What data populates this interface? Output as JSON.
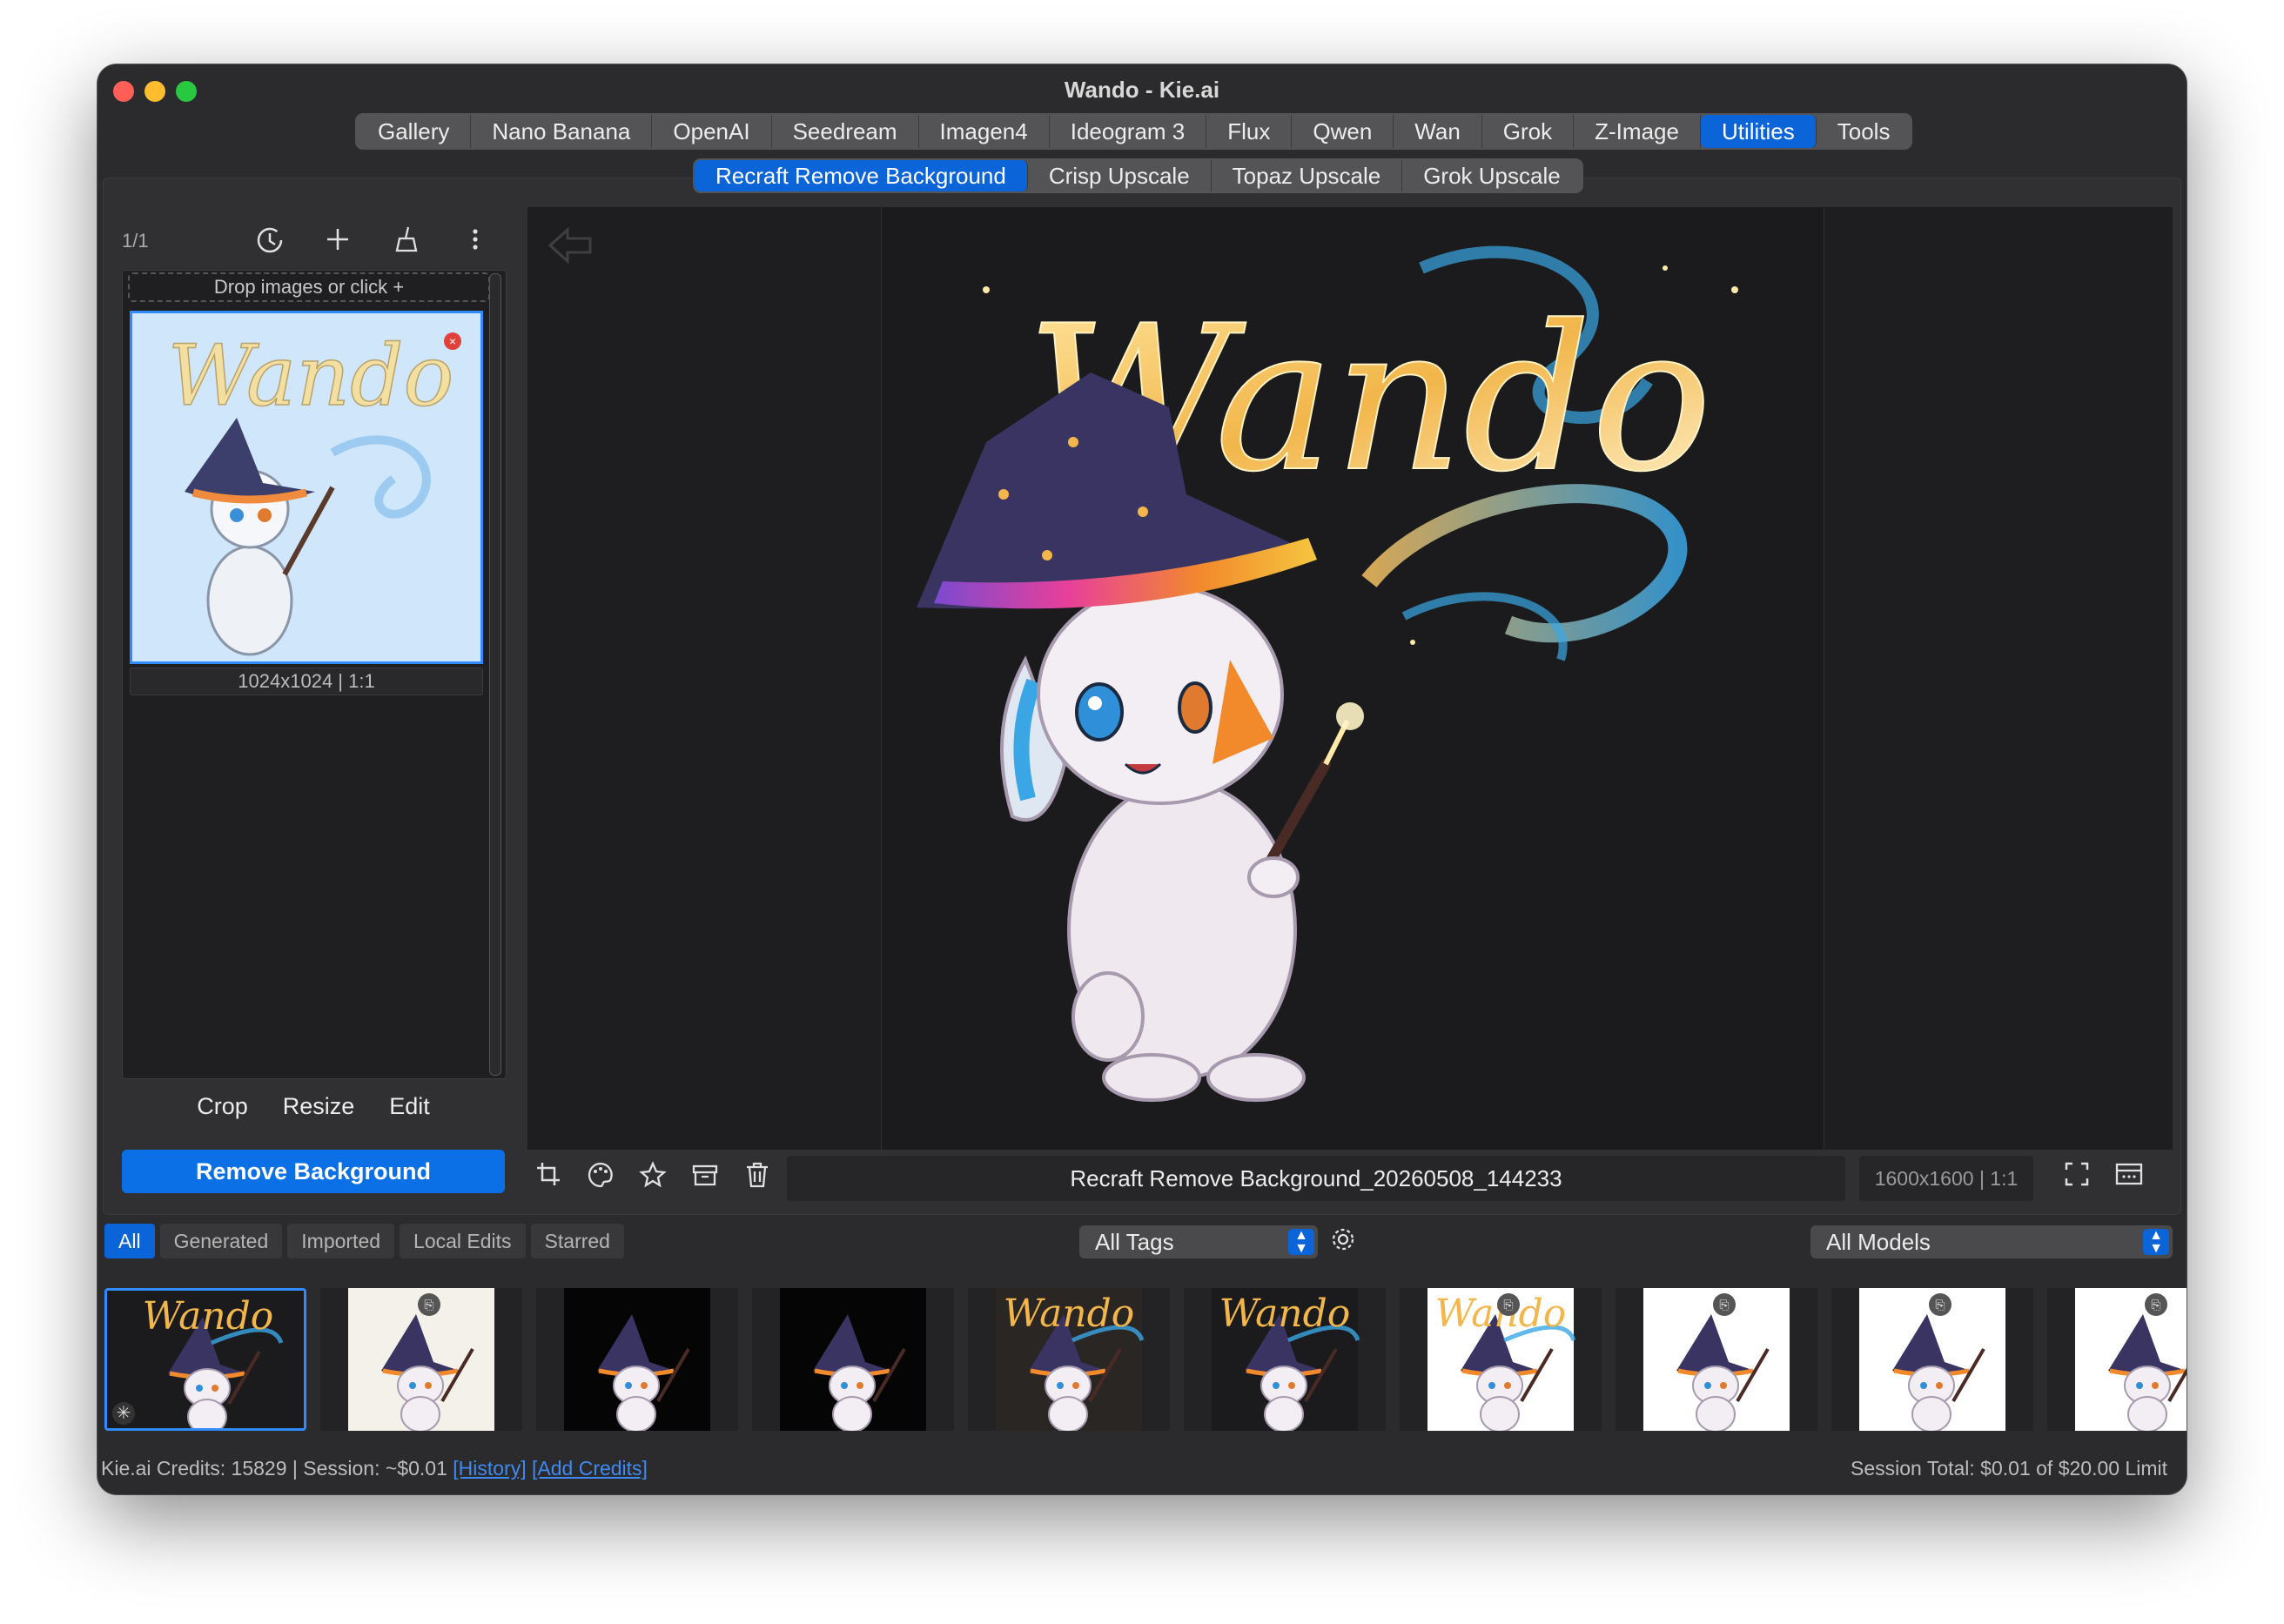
{
  "window": {
    "title": "Wando - Kie.ai"
  },
  "main_tabs": [
    {
      "label": "Gallery"
    },
    {
      "label": "Nano Banana"
    },
    {
      "label": "OpenAI"
    },
    {
      "label": "Seedream"
    },
    {
      "label": "Imagen4"
    },
    {
      "label": "Ideogram 3"
    },
    {
      "label": "Flux"
    },
    {
      "label": "Qwen"
    },
    {
      "label": "Wan"
    },
    {
      "label": "Grok"
    },
    {
      "label": "Z-Image"
    },
    {
      "label": "Utilities",
      "active": true
    },
    {
      "label": "Tools"
    }
  ],
  "sub_tabs": [
    {
      "label": "Recraft Remove Background",
      "active": true
    },
    {
      "label": "Crisp Upscale"
    },
    {
      "label": "Topaz Upscale"
    },
    {
      "label": "Grok Upscale"
    }
  ],
  "input_panel": {
    "counter": "1/1",
    "drop_hint": "Drop images or click +",
    "selected_image_caption": "1024x1024 | 1:1",
    "actions": [
      "Crop",
      "Resize",
      "Edit"
    ],
    "primary_button": "Remove Background",
    "icons": [
      "history-icon",
      "add-icon",
      "broom-icon",
      "more-icon"
    ]
  },
  "viewer": {
    "filename": "Recraft Remove Background_20260508_144233",
    "dimensions": "1600x1600 | 1:1",
    "image_text": "Wando",
    "toolbar_icons": [
      "crop-icon",
      "palette-icon",
      "star-icon",
      "archive-icon",
      "trash-icon"
    ]
  },
  "filters": [
    {
      "label": "All",
      "active": true
    },
    {
      "label": "Generated"
    },
    {
      "label": "Imported"
    },
    {
      "label": "Local Edits"
    },
    {
      "label": "Starred"
    }
  ],
  "tags_select": "All Tags",
  "models_select": "All Models",
  "thumbnails": [
    {
      "bg": "#1b1b1d",
      "has_text": true,
      "selected": true
    },
    {
      "bg": "#f4f1ea",
      "has_text": false,
      "badge": true
    },
    {
      "bg": "#050505",
      "has_text": false
    },
    {
      "bg": "#050505",
      "has_text": false
    },
    {
      "bg": "#2a2624",
      "has_text": true
    },
    {
      "bg": "#1b1b1d",
      "has_text": true
    },
    {
      "bg": "#ffffff",
      "has_text": true,
      "badge": true
    },
    {
      "bg": "#ffffff",
      "has_text": false,
      "badge": true
    },
    {
      "bg": "#ffffff",
      "has_text": false,
      "badge": true
    },
    {
      "bg": "#ffffff",
      "has_text": false,
      "badge": true
    }
  ],
  "footer": {
    "credits": "Kie.ai Credits: 15829 | Session: ~$0.01",
    "history_link": "[History]",
    "add_credits_link": "[Add Credits]",
    "session_total": "Session Total: $0.01 of $20.00 Limit"
  },
  "colors": {
    "accent": "#0b64d8",
    "window_bg": "#2b2b2d",
    "link": "#3d8bf2"
  }
}
